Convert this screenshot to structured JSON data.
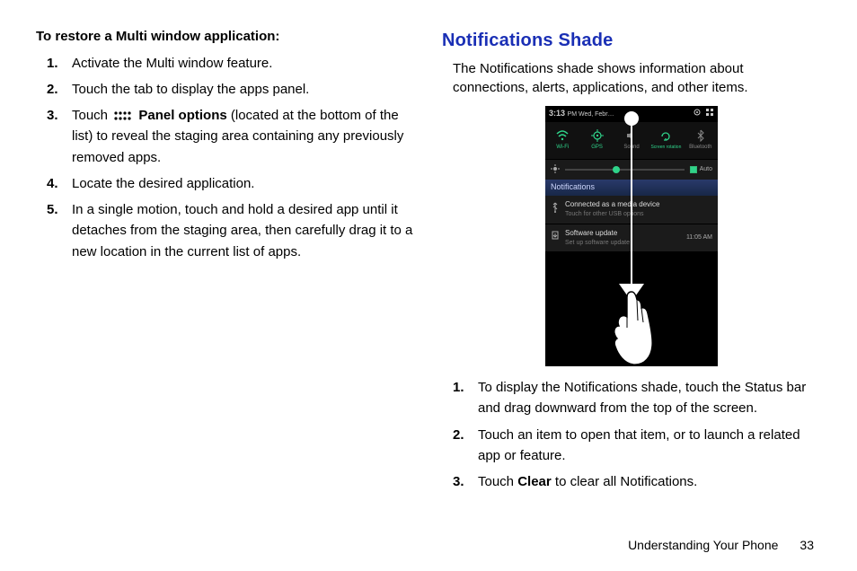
{
  "left": {
    "subheading": "To restore a Multi window application:",
    "steps": [
      "Activate the Multi window feature.",
      "Touch the tab to display the apps panel.",
      {
        "pre": "Touch ",
        "icon": "panel-options-icon",
        "bold": "Panel options",
        "post": " (located at the bottom of the list) to reveal the staging area containing any previously removed apps."
      },
      "Locate the desired application.",
      "In a single motion, touch and hold a desired app until it detaches from the staging area, then carefully drag it to a new location in the current list of apps."
    ]
  },
  "right": {
    "title": "Notifications Shade",
    "intro": "The Notifications shade shows information about connections, alerts, applications, and other items.",
    "phone": {
      "time": "3:13",
      "time_suffix": "PM Wed, Febr…",
      "qs": [
        {
          "label": "Wi-Fi",
          "active": true
        },
        {
          "label": "GPS",
          "active": true
        },
        {
          "label": "Sound",
          "active": false
        },
        {
          "label": "Screen rotation",
          "active": true
        },
        {
          "label": "Bluetooth",
          "active": false
        }
      ],
      "auto": "Auto",
      "notif_header": "Notifications",
      "notif1_title": "Connected as a media device",
      "notif1_sub": "Touch for other USB options",
      "notif2_title": "Software update",
      "notif2_sub": "Set up software update",
      "notif2_time": "11:05 AM"
    },
    "steps": [
      "To display the Notifications shade, touch the Status bar and drag downward from the top of the screen.",
      "Touch an item to open that item, or to launch a related app or feature.",
      {
        "pre": "Touch ",
        "bold": "Clear",
        "post": " to clear all Notifications."
      }
    ]
  },
  "footer": {
    "section": "Understanding Your Phone",
    "page": "33"
  }
}
